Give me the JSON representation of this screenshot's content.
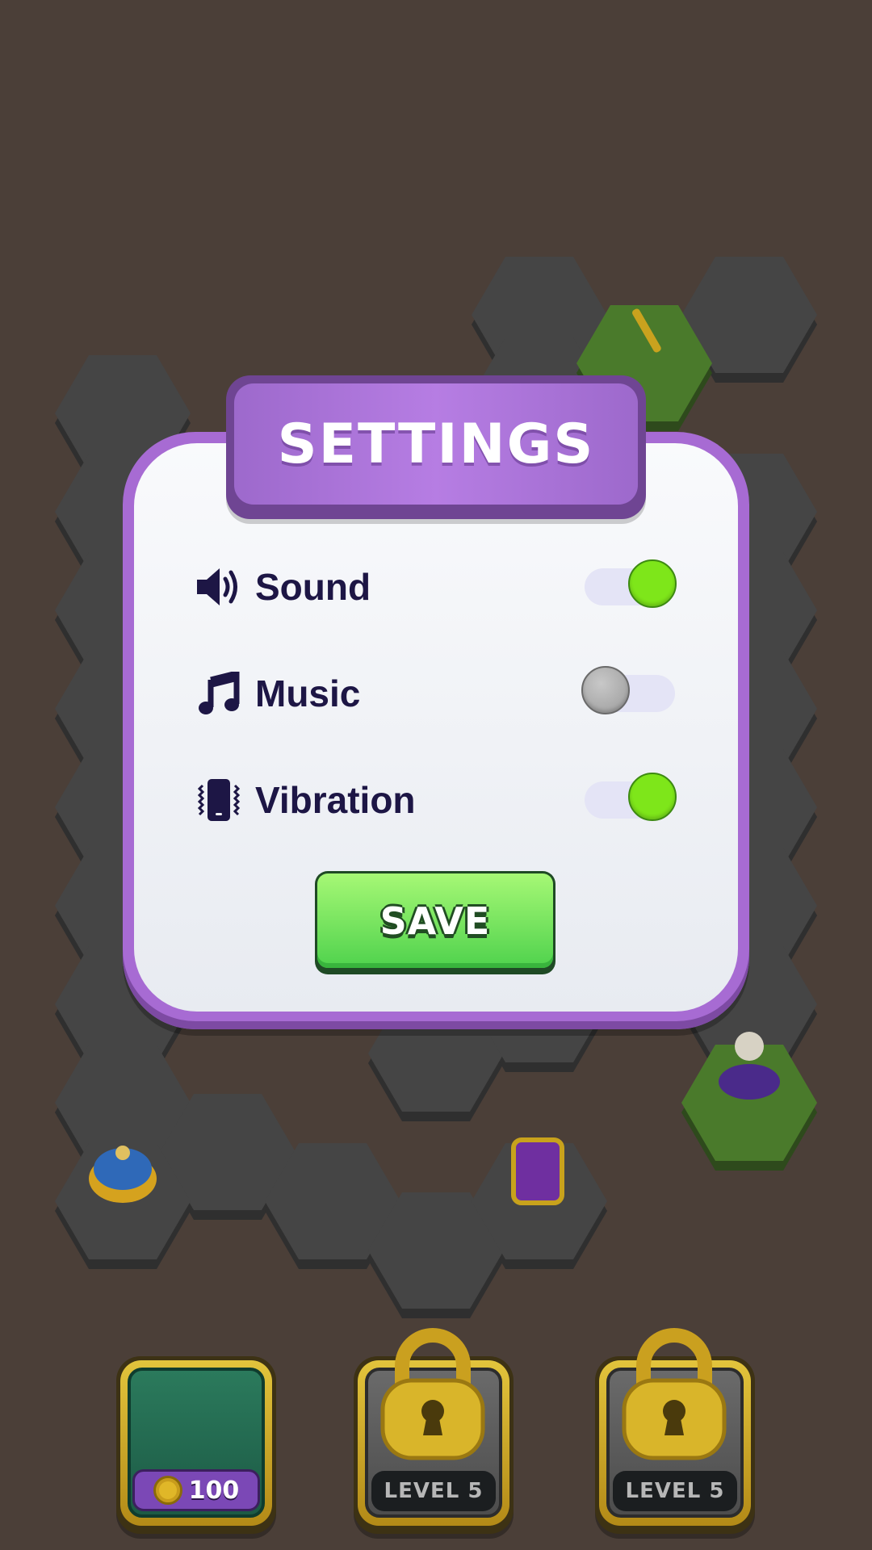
{
  "dialog": {
    "title": "SETTINGS",
    "settings": [
      {
        "label": "Sound",
        "icon": "speaker-icon",
        "enabled": true
      },
      {
        "label": "Music",
        "icon": "music-note-icon",
        "enabled": false
      },
      {
        "label": "Vibration",
        "icon": "phone-vibrate-icon",
        "enabled": true
      }
    ],
    "save_label": "SAVE"
  },
  "slots": [
    {
      "type": "purchase",
      "price": "100",
      "icon": "coin-icon"
    },
    {
      "type": "locked",
      "label": "LEVEL 5",
      "icon": "padlock-icon"
    },
    {
      "type": "locked",
      "label": "LEVEL 5",
      "icon": "padlock-icon"
    }
  ],
  "colors": {
    "background": "#4b3f38",
    "dialog_frame": "#a76bd3",
    "toggle_on": "#7ee61a",
    "toggle_off": "#a7a7a7",
    "save_button": "#4fd24d",
    "label_text": "#1d1645"
  }
}
